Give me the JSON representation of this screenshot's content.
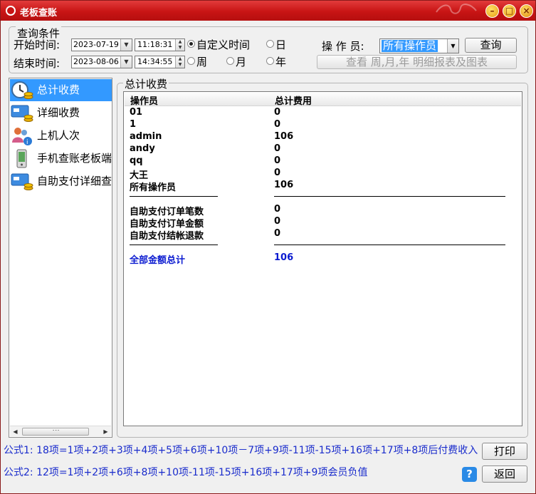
{
  "window": {
    "title": "老板查账",
    "minimize_glyph": "–",
    "maximize_glyph": "□",
    "close_glyph": "×"
  },
  "query": {
    "legend": "查询条件",
    "start_label": "开始时间:",
    "end_label": "结束时间:",
    "start_date": "2023-07-19",
    "start_time": "11:18:31",
    "end_date": "2023-08-06",
    "end_time": "14:34:55",
    "radios": {
      "custom": "自定义时间",
      "day": "日",
      "week": "周",
      "month": "月",
      "year": "年"
    },
    "selected_radio": "custom",
    "operator_label": "操 作 员:",
    "operator_value": "所有操作员",
    "query_button": "查询",
    "report_button": "查看 周,月,年 明细报表及图表"
  },
  "sidebar": {
    "items": [
      {
        "label": "总计收费",
        "icon": "clock-coins-icon",
        "selected": true
      },
      {
        "label": "详细收费",
        "icon": "card-coins-icon",
        "selected": false
      },
      {
        "label": "上机人次",
        "icon": "users-info-icon",
        "selected": false
      },
      {
        "label": "手机查账老板端",
        "icon": "mobile-phone-icon",
        "selected": false
      },
      {
        "label": "自助支付详细查",
        "icon": "self-pay-icon",
        "selected": false
      }
    ]
  },
  "summary": {
    "legend": "总计收费",
    "columns": [
      "操作员",
      "总计费用"
    ],
    "rows": [
      [
        "01",
        "0"
      ],
      [
        "1",
        "0"
      ],
      [
        "admin",
        "106"
      ],
      [
        "andy",
        "0"
      ],
      [
        "qq",
        "0"
      ],
      [
        "大王",
        "0"
      ],
      [
        "所有操作员",
        "106"
      ]
    ],
    "selfpay_rows": [
      [
        "自助支付订单笔数",
        "0"
      ],
      [
        "自助支付订单金额",
        "0"
      ],
      [
        "自助支付结帐退款",
        "0"
      ]
    ],
    "total": [
      "全部金额总计",
      "106"
    ]
  },
  "footer": {
    "formula1": "公式1: 18项=1项+2项+3项+4项+5项+6项+10项－7项+9项-11项-15项+16项+17项+8项后付费收入",
    "formula2": "公式2: 12项=1项+2项+6项+8项+10项-11项-15项+16项+17项+9项会员负值",
    "print_button": "打印",
    "back_button": "返回",
    "help_glyph": "?"
  },
  "colors": {
    "title_bar": "#c81414",
    "selection": "#3399ff",
    "formula_text": "#1a2ccc",
    "total_text": "#0a1ad0"
  }
}
